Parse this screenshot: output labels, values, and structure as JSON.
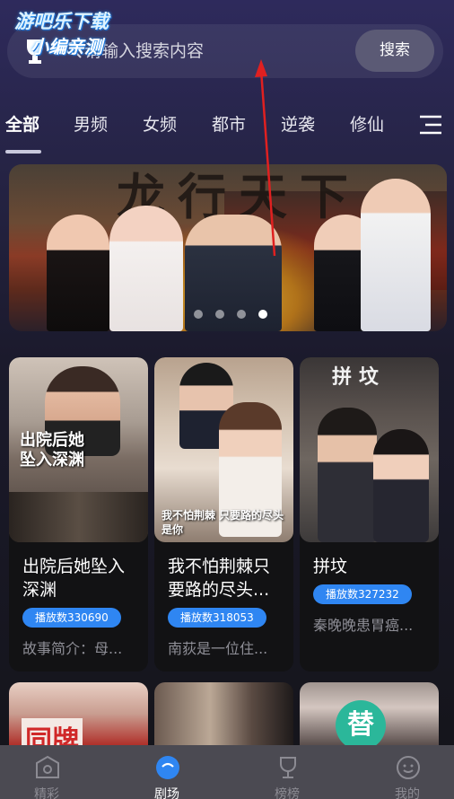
{
  "watermark": {
    "line1": "游吧乐下载",
    "line2": "小编亲测"
  },
  "search": {
    "placeholder": "请输入搜索内容",
    "button_label": "搜索"
  },
  "tabs": [
    {
      "label": "全部",
      "active": true
    },
    {
      "label": "男频"
    },
    {
      "label": "女频"
    },
    {
      "label": "都市"
    },
    {
      "label": "逆袭"
    },
    {
      "label": "修仙"
    }
  ],
  "banner": {
    "title_art": "龙行天下",
    "dots_count": 4,
    "active_dot": 4
  },
  "dramas": [
    {
      "title": "出院后她坠入深渊",
      "play_count": "播放数330690",
      "desc": "故事简介：母...",
      "poster_text": "出院后她坠入深渊"
    },
    {
      "title": "我不怕荆棘只要路的尽头...",
      "play_count": "播放数318053",
      "desc": "南荻是一位住...",
      "poster_text": "我不怕荆棘 只要路的尽头是你"
    },
    {
      "title": "拼坟",
      "play_count": "播放数327232",
      "desc": "秦晚晚患胃癌...",
      "poster_text": "拼坟"
    }
  ],
  "row2": {
    "badge_char": "替",
    "poster_text": "同牌"
  },
  "bottom_nav": [
    {
      "label": "精彩",
      "icon": "camera-icon"
    },
    {
      "label": "剧场",
      "icon": "theater-icon",
      "active": true
    },
    {
      "label": "榜榜",
      "icon": "trophy-icon"
    },
    {
      "label": "我的",
      "icon": "smile-icon"
    }
  ],
  "colors": {
    "accent": "#2f86f2",
    "nav_bg": "#4b4a52",
    "search_btn": "#5b5a75"
  }
}
